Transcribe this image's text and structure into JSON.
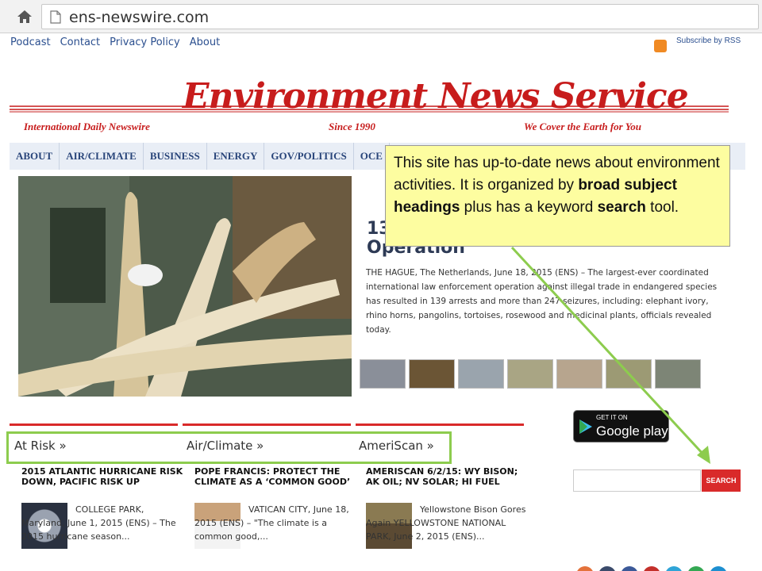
{
  "browser": {
    "url": "ens-newswire.com"
  },
  "toplinks": [
    "Podcast",
    "Contact",
    "Privacy Policy",
    "About"
  ],
  "rss_label": "Subscribe by RSS",
  "masthead": {
    "title": "Environment News Service",
    "tagline_left": "International Daily Newswire",
    "tagline_mid": "Since 1990",
    "tagline_right": "We Cover the Earth for You"
  },
  "nav": [
    "ABOUT",
    "AIR/CLIMATE",
    "BUSINESS",
    "ENERGY",
    "GOV/POLITICS",
    "OCE"
  ],
  "story": {
    "title_line1": "13",
    "title_line2": "Operation",
    "body": "THE HAGUE, The Netherlands, June 18, 2015 (ENS) – The largest-ever coordinated international law enforcement operation against illegal trade in endangered species has resulted in 139 arrests and more than 247 seizures, including: elephant ivory, rhino horns, pangolins, tortoises, rosewood and medicinal plants, officials revealed today."
  },
  "callout": {
    "part1": "This site has up-to-date news about environment activities.  It is organized by ",
    "bold1": "broad subject headings",
    "part2": " plus has a keyword ",
    "bold2": "search",
    "part3": " tool."
  },
  "sections": {
    "heads": [
      "At Risk »",
      "Air/Climate »",
      "AmeriScan »"
    ],
    "columns": [
      {
        "title": "2015 ATLANTIC HURRICANE RISK DOWN, PACIFIC RISK UP",
        "text": "COLLEGE PARK, Maryland, June 1, 2015 (ENS) – The 2015 hurricane season..."
      },
      {
        "title": "POPE FRANCIS: PROTECT THE CLIMATE AS A ‘COMMON GOOD’",
        "text": "VATICAN CITY, June 18, 2015 (ENS) – \"The climate is a common good,..."
      },
      {
        "title": "AMERISCAN 6/2/15: WY BISON; AK OIL; NV SOLAR; HI FUEL",
        "text": "Yellowstone Bison Gores Again YELLOWSTONE NATIONAL PARK, June 2, 2015 (ENS)..."
      }
    ]
  },
  "google_play": {
    "small": "GET IT ON",
    "big": "Google play"
  },
  "search": {
    "button": "SEARCH",
    "placeholder": ""
  },
  "colors": {
    "accent": "#c71c1c",
    "nav_text": "#29457a",
    "callout_bg": "#fdfda0",
    "highlight": "#8dcc4e"
  }
}
